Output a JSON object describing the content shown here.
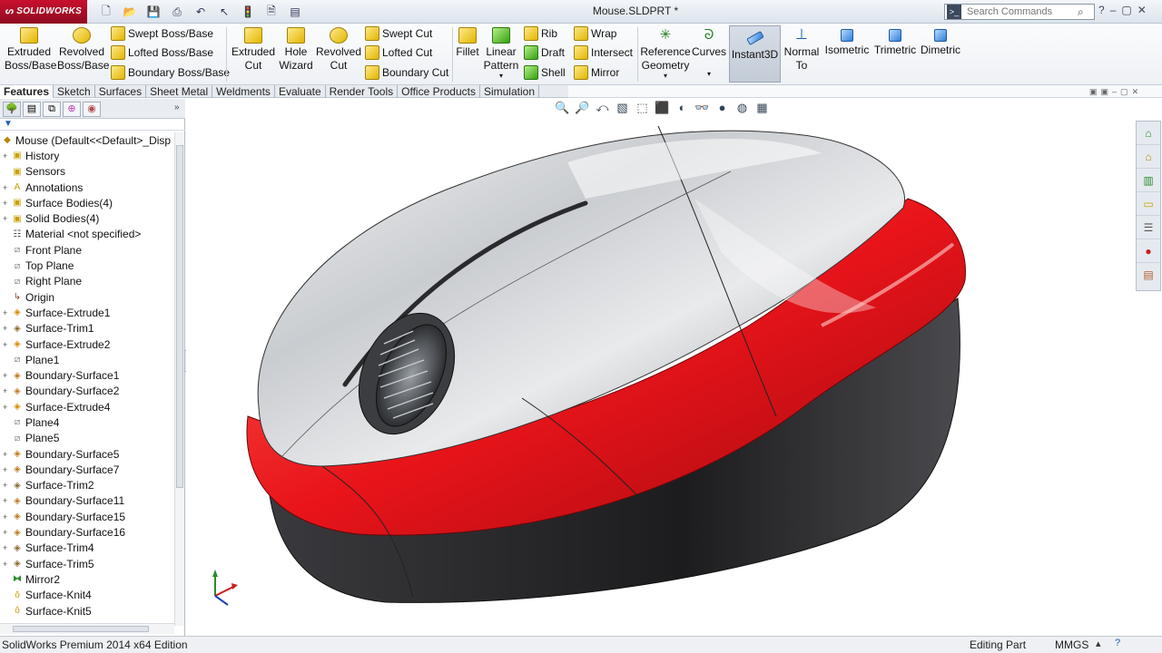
{
  "app": {
    "brand": "SOLIDWORKS",
    "document_title": "Mouse.SLDPRT *"
  },
  "search": {
    "placeholder": "Search Commands"
  },
  "ribbon": {
    "extruded_boss": "Extruded Boss/Base",
    "revolved_boss": "Revolved Boss/Base",
    "swept_boss": "Swept Boss/Base",
    "lofted_boss": "Lofted Boss/Base",
    "boundary_boss": "Boundary Boss/Base",
    "extruded_cut": "Extruded Cut",
    "hole_wizard": "Hole Wizard",
    "revolved_cut": "Revolved Cut",
    "swept_cut": "Swept Cut",
    "lofted_cut": "Lofted Cut",
    "boundary_cut": "Boundary Cut",
    "fillet": "Fillet",
    "linear_pattern": "Linear Pattern",
    "rib": "Rib",
    "draft": "Draft",
    "shell": "Shell",
    "wrap": "Wrap",
    "intersect": "Intersect",
    "mirror": "Mirror",
    "reference_geometry": "Reference Geometry",
    "curves": "Curves",
    "instant3d": "Instant3D",
    "normal_to": "Normal To",
    "isometric": "Isometric",
    "trimetric": "Trimetric",
    "dimetric": "Dimetric"
  },
  "tabs": [
    "Features",
    "Sketch",
    "Surfaces",
    "Sheet Metal",
    "Weldments",
    "Evaluate",
    "Render Tools",
    "Office Products",
    "Simulation"
  ],
  "tree": [
    {
      "label": "Mouse  (Default<<Default>_Disp",
      "icon": "part-icon",
      "glyph": "◆",
      "color": "#b8860b",
      "expand": ""
    },
    {
      "label": "History",
      "icon": "history-folder-icon",
      "glyph": "▣",
      "color": "#c9a000",
      "expand": "+"
    },
    {
      "label": "Sensors",
      "icon": "sensors-folder-icon",
      "glyph": "▣",
      "color": "#c9a000",
      "expand": ""
    },
    {
      "label": "Annotations",
      "icon": "annotations-icon",
      "glyph": "A",
      "color": "#c9a000",
      "expand": "+"
    },
    {
      "label": "Surface Bodies(4)",
      "icon": "surface-bodies-icon",
      "glyph": "▣",
      "color": "#c9a000",
      "expand": "+"
    },
    {
      "label": "Solid Bodies(4)",
      "icon": "solid-bodies-icon",
      "glyph": "▣",
      "color": "#c9a000",
      "expand": "+"
    },
    {
      "label": "Material <not specified>",
      "icon": "material-icon",
      "glyph": "☷",
      "color": "#555",
      "expand": ""
    },
    {
      "label": "Front Plane",
      "icon": "plane-icon",
      "glyph": "⧄",
      "color": "#777",
      "expand": ""
    },
    {
      "label": "Top Plane",
      "icon": "plane-icon",
      "glyph": "⧄",
      "color": "#777",
      "expand": ""
    },
    {
      "label": "Right Plane",
      "icon": "plane-icon",
      "glyph": "⧄",
      "color": "#777",
      "expand": ""
    },
    {
      "label": "Origin",
      "icon": "origin-icon",
      "glyph": "↳",
      "color": "#8a4a20",
      "expand": ""
    },
    {
      "label": "Surface-Extrude1",
      "icon": "surface-extrude-icon",
      "glyph": "◈",
      "color": "#d98a00",
      "expand": "+"
    },
    {
      "label": "Surface-Trim1",
      "icon": "surface-trim-icon",
      "glyph": "◈",
      "color": "#8a6a30",
      "expand": "+"
    },
    {
      "label": "Surface-Extrude2",
      "icon": "surface-extrude-icon",
      "glyph": "◈",
      "color": "#d98a00",
      "expand": "+"
    },
    {
      "label": "Plane1",
      "icon": "plane-icon",
      "glyph": "⧄",
      "color": "#777",
      "expand": ""
    },
    {
      "label": "Boundary-Surface1",
      "icon": "boundary-surface-icon",
      "glyph": "◈",
      "color": "#c07a20",
      "expand": "+"
    },
    {
      "label": "Boundary-Surface2",
      "icon": "boundary-surface-icon",
      "glyph": "◈",
      "color": "#c07a20",
      "expand": "+"
    },
    {
      "label": "Surface-Extrude4",
      "icon": "surface-extrude-icon",
      "glyph": "◈",
      "color": "#d98a00",
      "expand": "+"
    },
    {
      "label": "Plane4",
      "icon": "plane-icon",
      "glyph": "⧄",
      "color": "#777",
      "expand": ""
    },
    {
      "label": "Plane5",
      "icon": "plane-icon",
      "glyph": "⧄",
      "color": "#777",
      "expand": ""
    },
    {
      "label": "Boundary-Surface5",
      "icon": "boundary-surface-icon",
      "glyph": "◈",
      "color": "#c07a20",
      "expand": "+"
    },
    {
      "label": "Boundary-Surface7",
      "icon": "boundary-surface-icon",
      "glyph": "◈",
      "color": "#c07a20",
      "expand": "+"
    },
    {
      "label": "Surface-Trim2",
      "icon": "surface-trim-icon",
      "glyph": "◈",
      "color": "#8a6a30",
      "expand": "+"
    },
    {
      "label": "Boundary-Surface11",
      "icon": "boundary-surface-icon",
      "glyph": "◈",
      "color": "#c07a20",
      "expand": "+"
    },
    {
      "label": "Boundary-Surface15",
      "icon": "boundary-surface-icon",
      "glyph": "◈",
      "color": "#c07a20",
      "expand": "+"
    },
    {
      "label": "Boundary-Surface16",
      "icon": "boundary-surface-icon",
      "glyph": "◈",
      "color": "#c07a20",
      "expand": "+"
    },
    {
      "label": "Surface-Trim4",
      "icon": "surface-trim-icon",
      "glyph": "◈",
      "color": "#8a6a30",
      "expand": "+"
    },
    {
      "label": "Surface-Trim5",
      "icon": "surface-trim-icon",
      "glyph": "◈",
      "color": "#8a6a30",
      "expand": "+"
    },
    {
      "label": "Mirror2",
      "icon": "mirror-icon",
      "glyph": "⧓",
      "color": "#2d8a2d",
      "expand": ""
    },
    {
      "label": "Surface-Knit4",
      "icon": "surface-knit-icon",
      "glyph": "ǒ",
      "color": "#c9a000",
      "expand": ""
    },
    {
      "label": "Surface-Knit5",
      "icon": "surface-knit-icon",
      "glyph": "ǒ",
      "color": "#c9a000",
      "expand": ""
    }
  ],
  "status": {
    "edition": "SolidWorks Premium 2014 x64 Edition",
    "mode": "Editing Part",
    "units": "MMGS"
  },
  "colors": {
    "body_red": "#e8141a",
    "shell_silver": "#d4d6d8",
    "base_dark": "#1c1c1e",
    "brand": "#c8102e"
  }
}
